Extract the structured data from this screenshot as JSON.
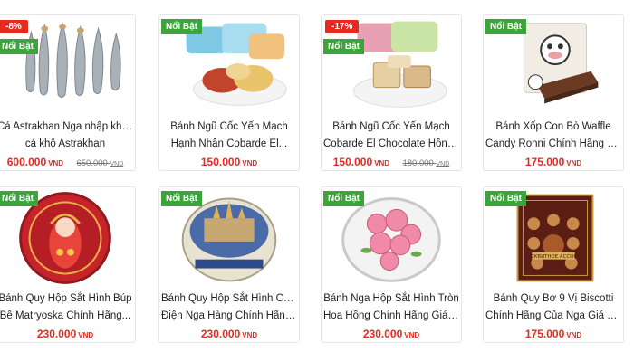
{
  "products": [
    {
      "title_line1": "Cá Astrakhan Nga nhập khẩu -",
      "title_line2": "cá khô Astrakhan",
      "price": "600.000",
      "currency": "VND",
      "old_price": "650.000",
      "old_currency": "VND",
      "discount": "-8%",
      "featured": "Nổi Bật"
    },
    {
      "title_line1": "Bánh Ngũ Cốc Yến Mạch",
      "title_line2": "Hạnh Nhân Cobarde El...",
      "price": "150.000",
      "currency": "VND",
      "featured": "Nổi Bật"
    },
    {
      "title_line1": "Bánh Ngũ Cốc Yến Mạch",
      "title_line2": "Cobarde El Chocolate Hồng...",
      "price": "150.000",
      "currency": "VND",
      "old_price": "180.000",
      "old_currency": "VND",
      "discount": "-17%",
      "featured": "Nổi Bật"
    },
    {
      "title_line1": "Bánh Xốp Con Bò Waffle",
      "title_line2": "Candy Ronni Chính Hãng C...",
      "price": "175.000",
      "currency": "VND",
      "featured": "Nổi Bật"
    },
    {
      "title_line1": "Bánh Quy Hộp Sắt Hình Búp",
      "title_line2": "Bê Matryoska Chính Hãng...",
      "price": "230.000",
      "currency": "VND",
      "featured": "Nổi Bật"
    },
    {
      "title_line1": "Bánh Quy Hộp Sắt Hình Cung",
      "title_line2": "Điện Nga Hàng Chính Hãng...",
      "price": "230.000",
      "currency": "VND",
      "featured": "Nổi Bật"
    },
    {
      "title_line1": "Bánh Nga Hộp Sắt Hình Tròn",
      "title_line2": "Hoa Hồng Chính Hãng Giá Rẻ",
      "price": "230.000",
      "currency": "VND",
      "featured": "Nổi Bật"
    },
    {
      "title_line1": "Bánh Quy Bơ 9 Vị Biscotti",
      "title_line2": "Chính Hãng Của Nga Giá Tốt",
      "price": "175.000",
      "currency": "VND",
      "featured": "Nổi Bật",
      "box_label": "БИСКВИТНОЕ АССОРТИ"
    }
  ]
}
